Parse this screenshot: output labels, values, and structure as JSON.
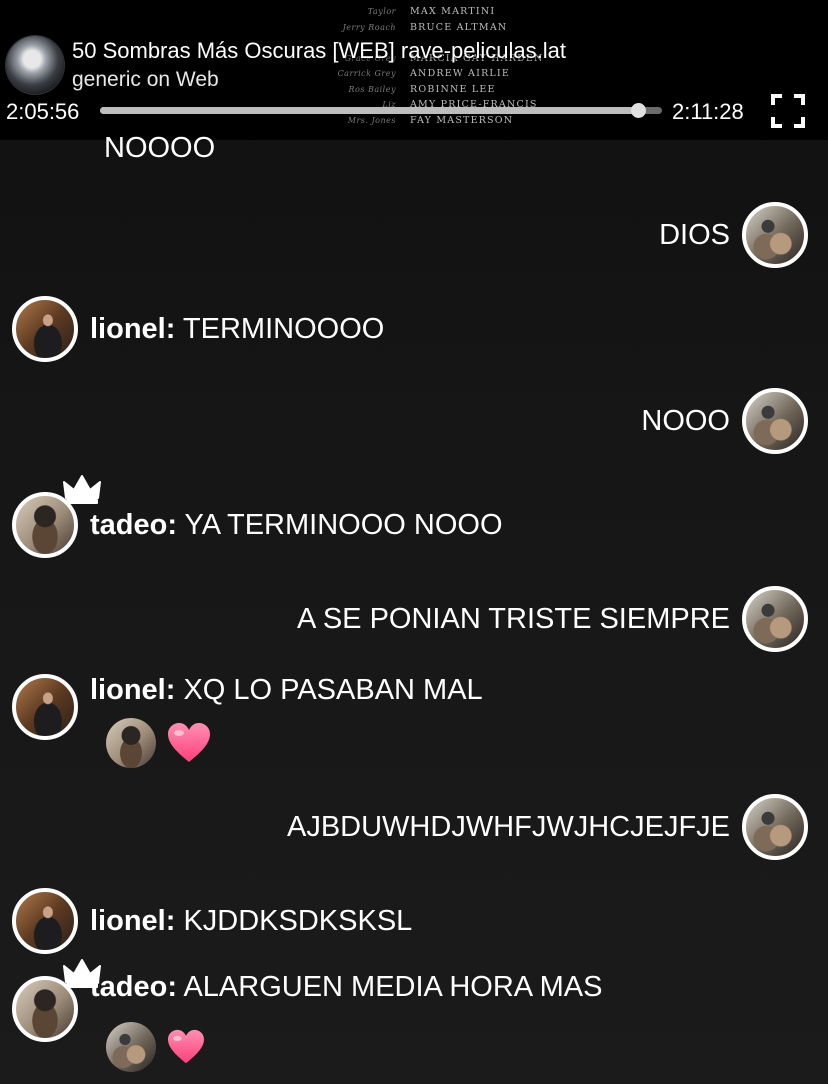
{
  "video": {
    "title": "50 Sombras Más Oscuras [WEB] rave-peliculas.lat",
    "subtitle": "generic on Web",
    "current_time": "2:05:56",
    "duration": "2:11:28",
    "progress": 0.958,
    "credits": [
      {
        "role": "Taylor",
        "name": "MAX MARTINI"
      },
      {
        "role": "Jerry Roach",
        "name": "BRUCE ALTMAN"
      },
      {
        "role": "",
        "name": ""
      },
      {
        "role": "Grace Grey",
        "name": "MARCIA GAY HARDEN"
      },
      {
        "role": "Carrick Grey",
        "name": "ANDREW AIRLIE"
      },
      {
        "role": "Ros Bailey",
        "name": "ROBINNE LEE"
      },
      {
        "role": "Liz",
        "name": "AMY PRICE-FRANCIS"
      },
      {
        "role": "Mrs. Jones",
        "name": "FAY MASTERSON"
      }
    ],
    "fullscreen_icon": "fullscreen-icon"
  },
  "chat": {
    "partial_top": "NOOOO",
    "messages": [
      {
        "side": "right",
        "text": "DIOS"
      },
      {
        "side": "left",
        "user": "lionel:",
        "text": " TERMINOOOO"
      },
      {
        "side": "right",
        "text": "NOOO"
      },
      {
        "side": "left",
        "user": "tadeo:",
        "text": " YA TERMINOOO NOOO"
      },
      {
        "side": "right",
        "text": "A SE PONIAN TRISTE SIEMPRE"
      },
      {
        "side": "left",
        "user": "lionel:",
        "text": " XQ LO PASABAN MAL"
      },
      {
        "side": "right",
        "text": "AJBDUWHDJWHFJWJHCJEJFJE"
      },
      {
        "side": "left",
        "user": "lionel:",
        "text": " KJDDKSDKSKSL"
      },
      {
        "side": "left",
        "user": "tadeo:",
        "text": " ALARGUEN MEDIA HORA MAS"
      }
    ],
    "colors": {
      "heart": "#ff5a8a",
      "accent": "#ffffff"
    }
  }
}
